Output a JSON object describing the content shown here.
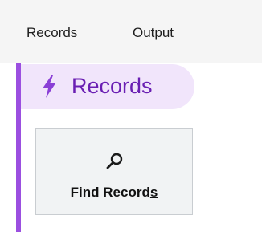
{
  "menubar": {
    "items": [
      {
        "label": "Records"
      },
      {
        "label": "Output"
      }
    ]
  },
  "section": {
    "title": "Records",
    "icon": "lightning-bolt-icon",
    "accent_color": "#9b4fe0",
    "pill_color": "#f1e5fb"
  },
  "actions": {
    "find_records": {
      "label_main": "Find Record",
      "label_mnemonic": "s",
      "icon": "search-icon"
    }
  }
}
